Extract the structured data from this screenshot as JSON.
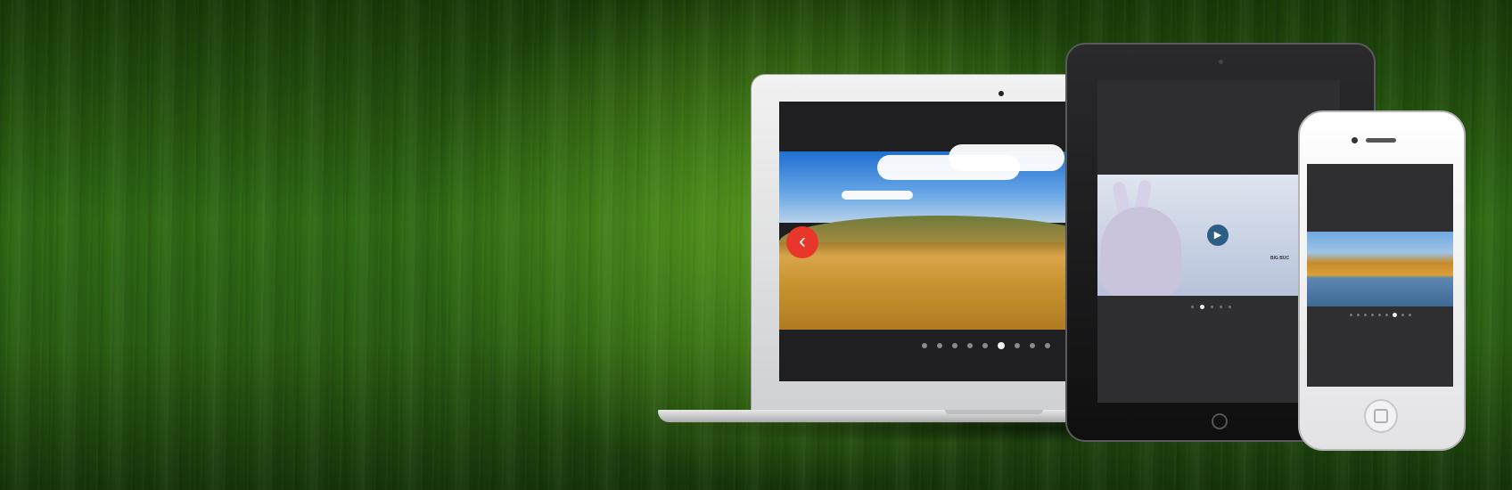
{
  "banner": {
    "background_color": "#2f6a14",
    "devices": [
      "laptop",
      "tablet",
      "phone"
    ]
  },
  "laptop": {
    "slider": {
      "prev_icon": "chevron-left-icon",
      "prev_glyph": "‹",
      "accent_color": "#e8372a",
      "dot_count": 9,
      "active_dot": 5
    }
  },
  "tablet": {
    "video": {
      "play_icon": "play-icon",
      "play_glyph": "▶",
      "title": "BIG BUC"
    },
    "slider": {
      "dot_count": 5,
      "active_dot": 1
    }
  },
  "phone": {
    "slider": {
      "dot_count": 9,
      "active_dot": 7
    }
  }
}
